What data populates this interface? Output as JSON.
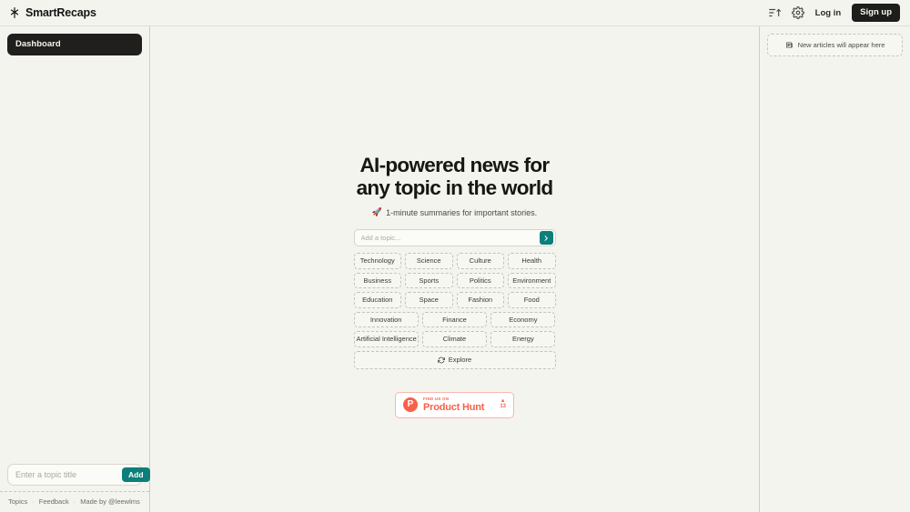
{
  "header": {
    "brand": "SmartRecaps",
    "brand_icon": "asterisk-icon",
    "sort_icon": "sort-ascending-icon",
    "settings_icon": "gear-icon",
    "login_label": "Log in",
    "signup_label": "Sign up"
  },
  "sidebar": {
    "nav": [
      {
        "label": "Dashboard",
        "active": true
      }
    ],
    "add_topic": {
      "placeholder": "Enter a topic title",
      "value": "",
      "button_label": "Add"
    },
    "footer": {
      "topics": "Topics",
      "sep1": "·",
      "feedback": "Feedback",
      "sep2": "·",
      "credit": "Made by @leewlms"
    }
  },
  "main": {
    "title_line1": "AI-powered news for",
    "title_line2": "any topic in the world",
    "subtitle_icon": "rocket-icon",
    "subtitle": "1-minute summaries for important stories.",
    "search": {
      "placeholder": "Add a topic...",
      "value": "",
      "submit_icon": "chevron-right-icon"
    },
    "chip_rows": [
      [
        "Technology",
        "Science",
        "Culture",
        "Health"
      ],
      [
        "Business",
        "Sports",
        "Politics",
        "Environment"
      ],
      [
        "Education",
        "Space",
        "Fashion",
        "Food"
      ],
      [
        "Innovation",
        "Finance",
        "Economy"
      ],
      [
        "Artificial Intelligence",
        "Climate",
        "Energy"
      ]
    ],
    "explore": {
      "label": "Explore",
      "icon": "refresh-icon"
    },
    "product_hunt": {
      "kicker": "FIND US ON",
      "name": "Product Hunt",
      "logo_letter": "P",
      "vote_arrow": "▲",
      "vote_count": "13"
    }
  },
  "right_panel": {
    "empty_state": {
      "icon": "newspaper-icon",
      "text": "New articles will appear here"
    }
  },
  "colors": {
    "page_bg": "#f4f4ef",
    "accent_teal": "#0d7f7a",
    "dark": "#1d1d1b",
    "product_hunt_orange": "#f8604a"
  }
}
